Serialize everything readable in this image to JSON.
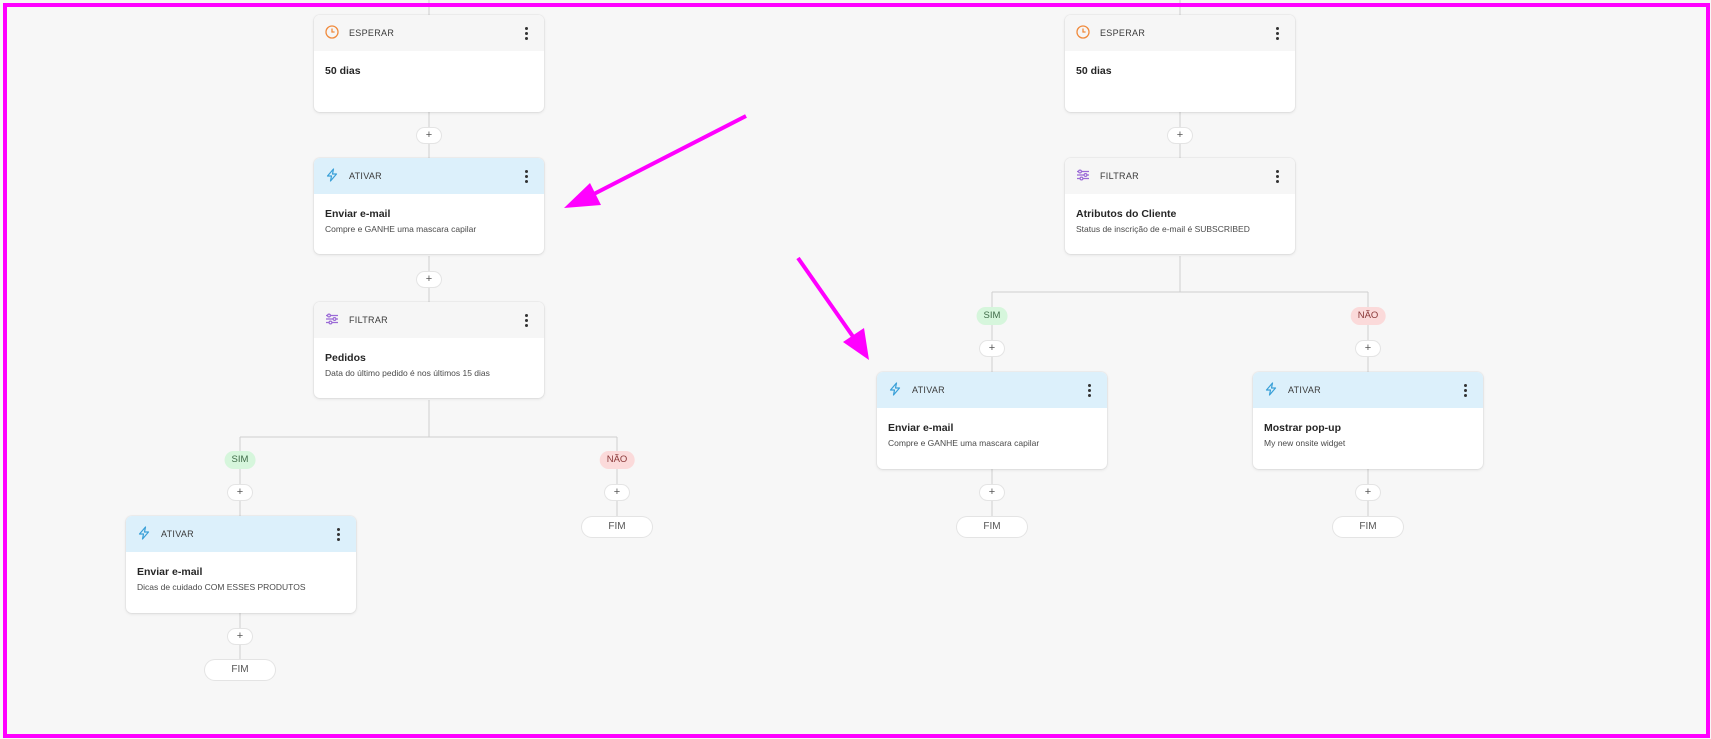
{
  "colors": {
    "frame": "#ff00ff",
    "arrow": "#ff00ff",
    "ativar_header": "#dcf0fb",
    "sim_badge": "#d6f6dc",
    "nao_badge": "#fbdada",
    "ativar_icon": "#3aa0d8",
    "esperar_icon": "#f08a3c",
    "filtrar_icon": "#9b6bd6"
  },
  "nodes": {
    "wait_left": {
      "type": "ESPERAR",
      "icon": "clock-icon",
      "title": "50 dias",
      "desc": ""
    },
    "wait_right": {
      "type": "ESPERAR",
      "icon": "clock-icon",
      "title": "50 dias",
      "desc": ""
    },
    "act_email_1": {
      "type": "ATIVAR",
      "icon": "lightning-icon",
      "title": "Enviar e-mail",
      "desc": "Compre e GANHE uma mascara capilar"
    },
    "filter_orders": {
      "type": "FILTRAR",
      "icon": "filter-icon",
      "title": "Pedidos",
      "desc": "Data do último pedido é nos últimos 15 dias"
    },
    "filter_attrs": {
      "type": "FILTRAR",
      "icon": "filter-icon",
      "title": "Atributos do Cliente",
      "desc": "Status de inscrição de e-mail é SUBSCRIBED"
    },
    "act_email_care": {
      "type": "ATIVAR",
      "icon": "lightning-icon",
      "title": "Enviar e-mail",
      "desc": "Dicas de cuidado COM ESSES PRODUTOS"
    },
    "act_email_2": {
      "type": "ATIVAR",
      "icon": "lightning-icon",
      "title": "Enviar e-mail",
      "desc": "Compre e GANHE uma mascara capilar"
    },
    "act_popup": {
      "type": "ATIVAR",
      "icon": "lightning-icon",
      "title": "Mostrar pop-up",
      "desc": "My new onsite widget"
    }
  },
  "branches": {
    "yes": "SIM",
    "no": "NÃO"
  },
  "controls": {
    "add": "+",
    "end": "FIM"
  }
}
